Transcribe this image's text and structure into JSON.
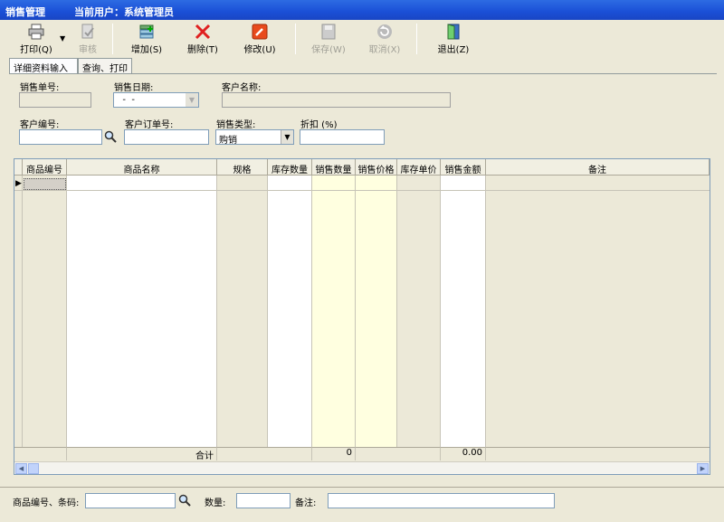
{
  "window": {
    "title": "销售管理",
    "user_label": "当前用户：系统管理员"
  },
  "toolbar": {
    "print": "打印(Q)",
    "audit": "审核",
    "add": "增加(S)",
    "delete": "删除(T)",
    "edit": "修改(U)",
    "save": "保存(W)",
    "cancel": "取消(X)",
    "exit": "退出(Z)"
  },
  "tabs": [
    "详细资料输入",
    "查询、打印"
  ],
  "form": {
    "sale_no_label": "销售单号:",
    "sale_no": "",
    "sale_date_label": "销售日期:",
    "sale_date": "  -  -",
    "customer_name_label": "客户名称:",
    "customer_name": "",
    "customer_no_label": "客户编号:",
    "customer_no": "",
    "customer_order_label": "客户订单号:",
    "customer_order": "",
    "sale_type_label": "销售类型:",
    "sale_type": "购销",
    "discount_label": "折扣 (%)",
    "discount": ""
  },
  "grid": {
    "columns": [
      "商品编号",
      "商品名称",
      "规格",
      "库存数量",
      "销售数量",
      "销售价格",
      "库存单价",
      "销售金额",
      "备注"
    ],
    "total_label": "合计",
    "total_qty": "0",
    "total_amount": "0.00"
  },
  "bottom": {
    "barcode_label": "商品编号、条码:",
    "barcode": "",
    "qty_label": "数量:",
    "qty": "",
    "remark_label": "备注:",
    "remark": ""
  },
  "colors": {
    "title_bar": "#1a4fd6",
    "highlight_col": "#ffffe0",
    "window_bg": "#ece9d8"
  }
}
